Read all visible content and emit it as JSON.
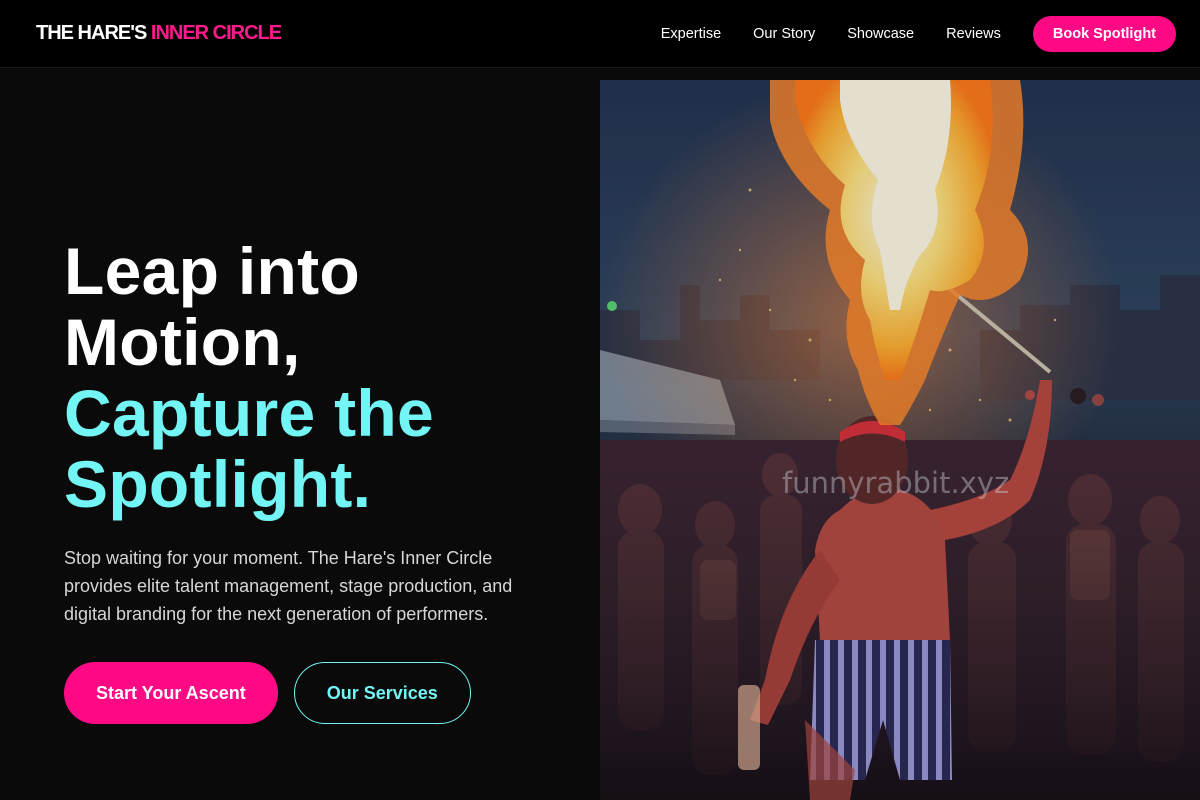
{
  "nav": {
    "logo_part1": "THE HARE'S",
    "logo_part2": "INNER CIRCLE",
    "links": [
      "Expertise",
      "Our Story",
      "Showcase",
      "Reviews"
    ],
    "cta_label": "Book Spotlight"
  },
  "hero": {
    "headline_lines": [
      "Leap into",
      "Motion,"
    ],
    "headline_accent_lines": [
      "Capture the",
      "Spotlight."
    ],
    "lead": "Stop waiting for your moment. The Hare's Inner Circle provides elite talent management, stage production, and digital branding for the next generation of performers.",
    "primary_cta": "Start Your Ascent",
    "secondary_cta": "Our Services"
  },
  "image": {
    "watermark": "funnyrabbit.xyz",
    "subject": "fire-breather-performance-photo"
  },
  "colors": {
    "accent_pink": "#ff0a84",
    "accent_cyan": "#73f5f5",
    "background": "#0a0a0a"
  }
}
